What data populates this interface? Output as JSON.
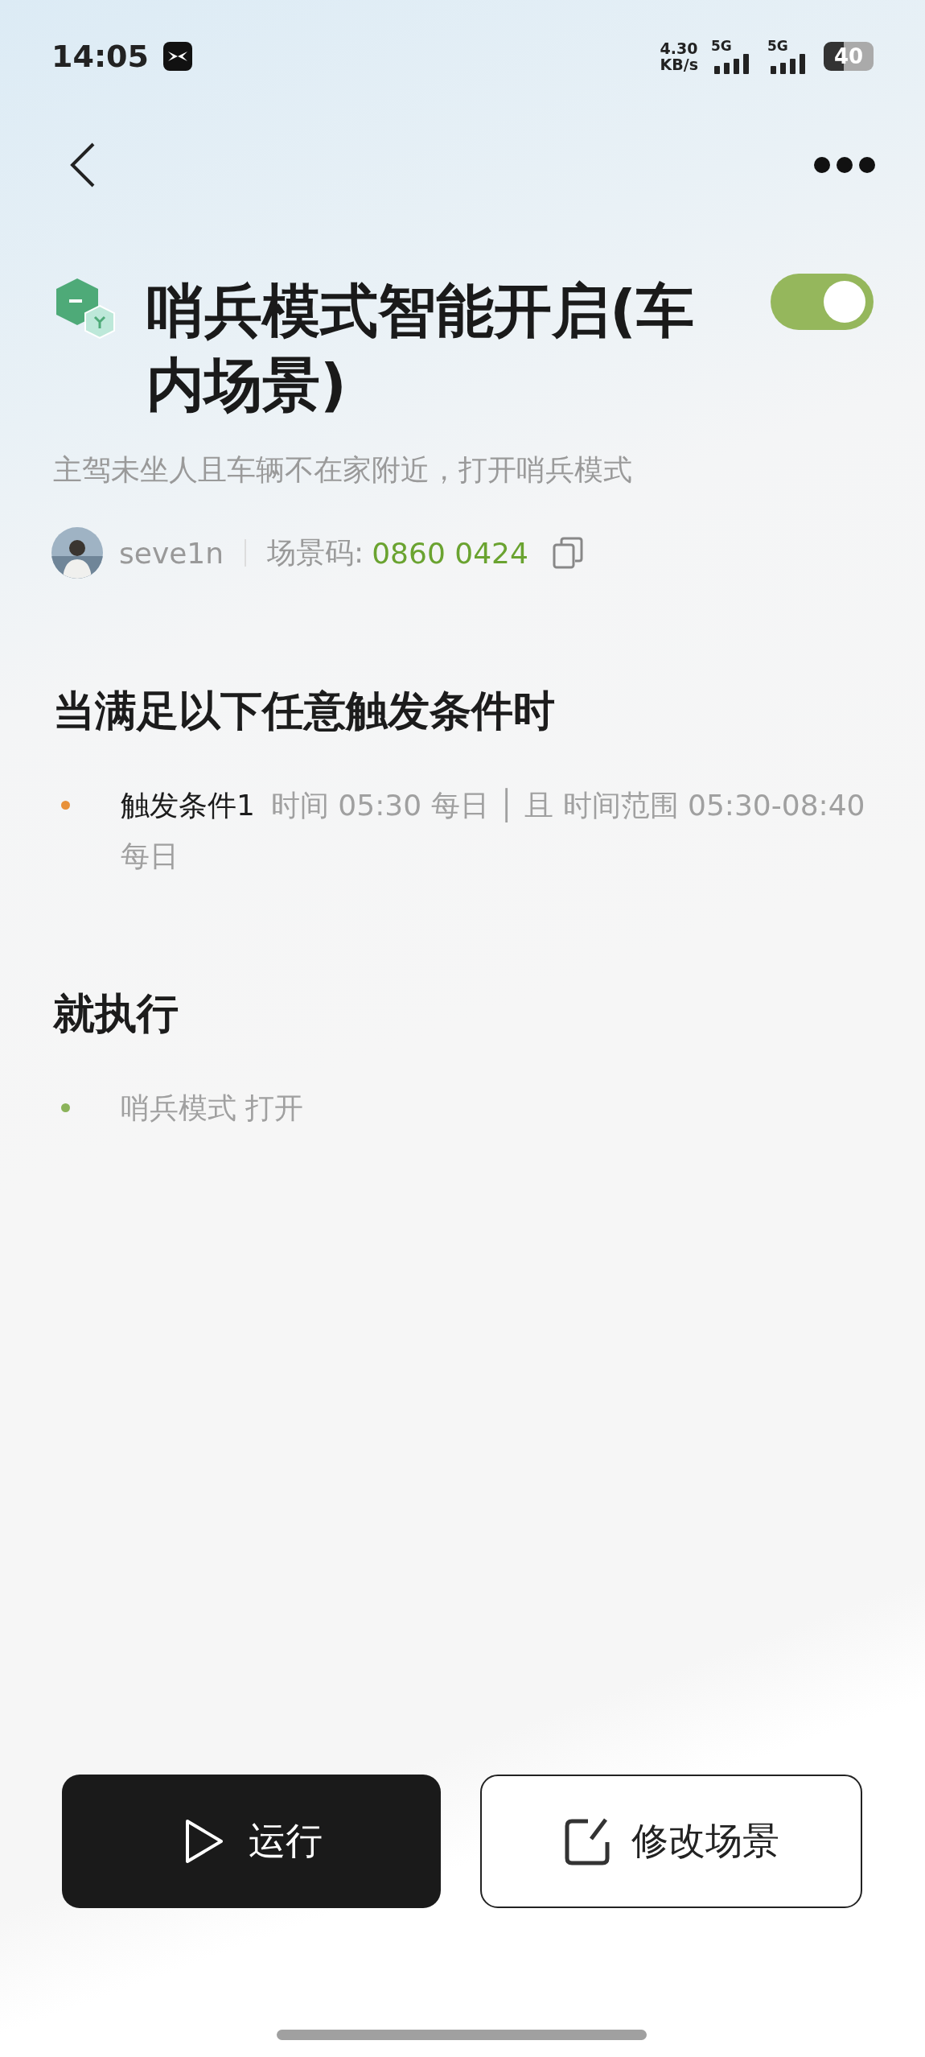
{
  "status_bar": {
    "time": "14:05",
    "speed": "4.30",
    "speed_unit": "KB/s",
    "sim1": "5G",
    "sim2": "5G",
    "battery": "40"
  },
  "scene": {
    "title": "哨兵模式智能开启(车内场景)",
    "enabled": true,
    "description": "主驾未坐人且车辆不在家附近，打开哨兵模式",
    "author": "seve1n",
    "code_label": "场景码:",
    "code": "0860 0424"
  },
  "triggers": {
    "heading": "当满足以下任意触发条件时",
    "items": [
      {
        "title": "触发条件1",
        "detail": "时间 05:30 每日 │ 且 时间范围 05:30-08:40 每日",
        "color": "#e8913a"
      }
    ]
  },
  "actions": {
    "heading": "就执行",
    "items": [
      {
        "title": "哨兵模式 打开",
        "color": "#8bb35a"
      }
    ]
  },
  "buttons": [
    {
      "kind": "run",
      "label": "运行"
    },
    {
      "kind": "edit",
      "label": "修改场景"
    }
  ]
}
